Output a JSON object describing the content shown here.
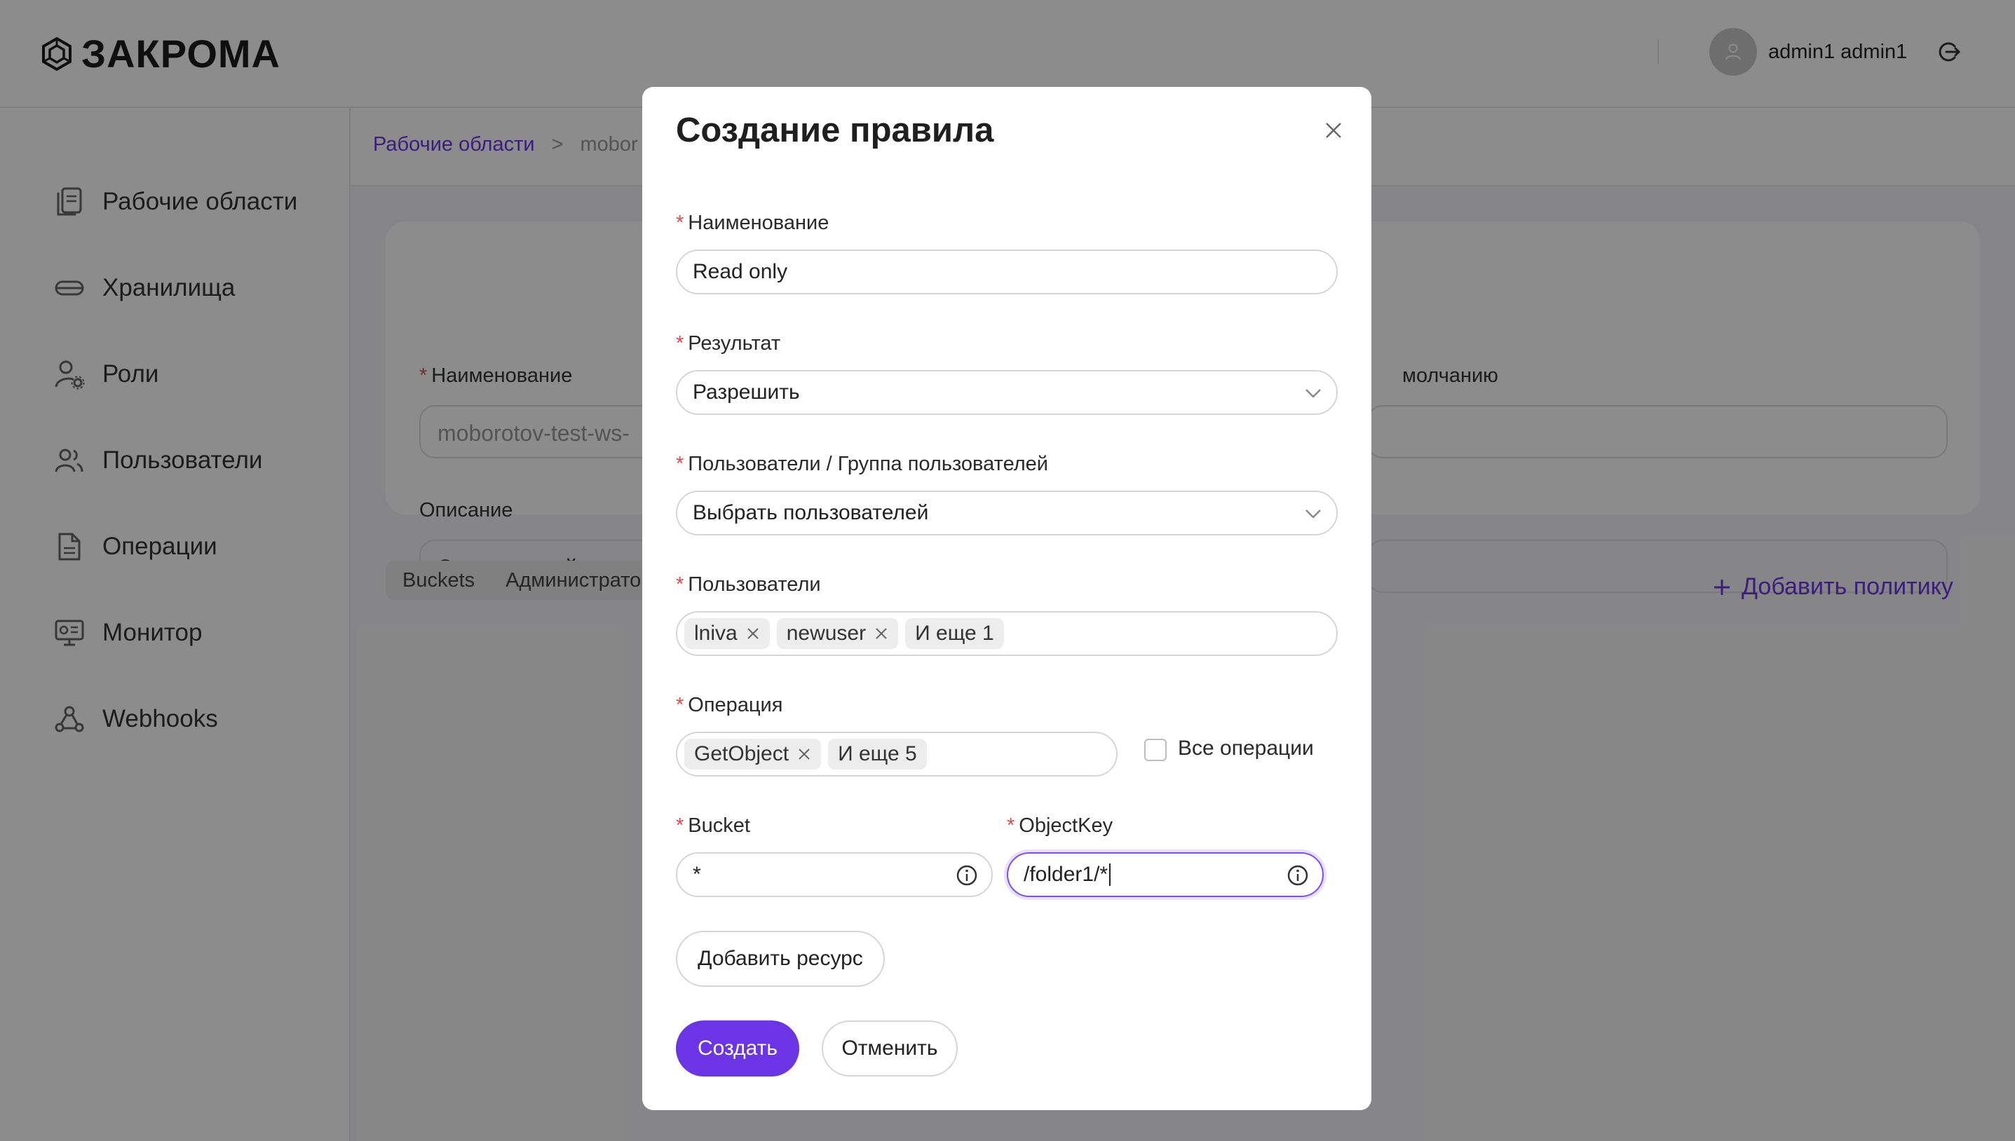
{
  "app": {
    "logo_text": "ЗАКРОМА",
    "username": "admin1 admin1"
  },
  "sidebar": {
    "items": [
      {
        "label": "Рабочие области",
        "icon": "documents-icon"
      },
      {
        "label": "Хранилища",
        "icon": "storage-icon"
      },
      {
        "label": "Роли",
        "icon": "user-gear-icon"
      },
      {
        "label": "Пользователи",
        "icon": "users-icon"
      },
      {
        "label": "Операции",
        "icon": "document-icon"
      },
      {
        "label": "Монитор",
        "icon": "monitor-icon"
      },
      {
        "label": "Webhooks",
        "icon": "webhooks-icon"
      }
    ]
  },
  "breadcrumb": {
    "root": "Рабочие области",
    "separator": ">",
    "current": "mobor"
  },
  "workspace": {
    "name_label": "Наименование",
    "name_value": "moborotov-test-ws-",
    "default_label": "молчанию",
    "description_label": "Описание",
    "description_value": "Это воркспейс для"
  },
  "tabs": [
    "Buckets",
    "Администрато"
  ],
  "add_policy_label": "Добавить политику",
  "modal": {
    "title": "Создание правила",
    "name_label": "Наименование",
    "name_value": "Read only",
    "result_label": "Результат",
    "result_value": "Разрешить",
    "users_group_label": "Пользователи / Группа пользователей",
    "users_group_value": "Выбрать пользователей",
    "users_label": "Пользователи",
    "users_tags": [
      "lniva",
      "newuser"
    ],
    "users_more": "И еще 1",
    "operation_label": "Операция",
    "operation_tags": [
      "GetObject"
    ],
    "operation_more": "И еще 5",
    "all_operations_label": "Все операции",
    "all_operations_checked": false,
    "bucket_label": "Bucket",
    "bucket_value": "*",
    "objectkey_label": "ObjectKey",
    "objectkey_value": "/folder1/*",
    "add_resource_label": "Добавить ресурс",
    "create_label": "Создать",
    "cancel_label": "Отменить"
  },
  "colors": {
    "accent": "#6b35e6",
    "required": "#e5484d"
  }
}
